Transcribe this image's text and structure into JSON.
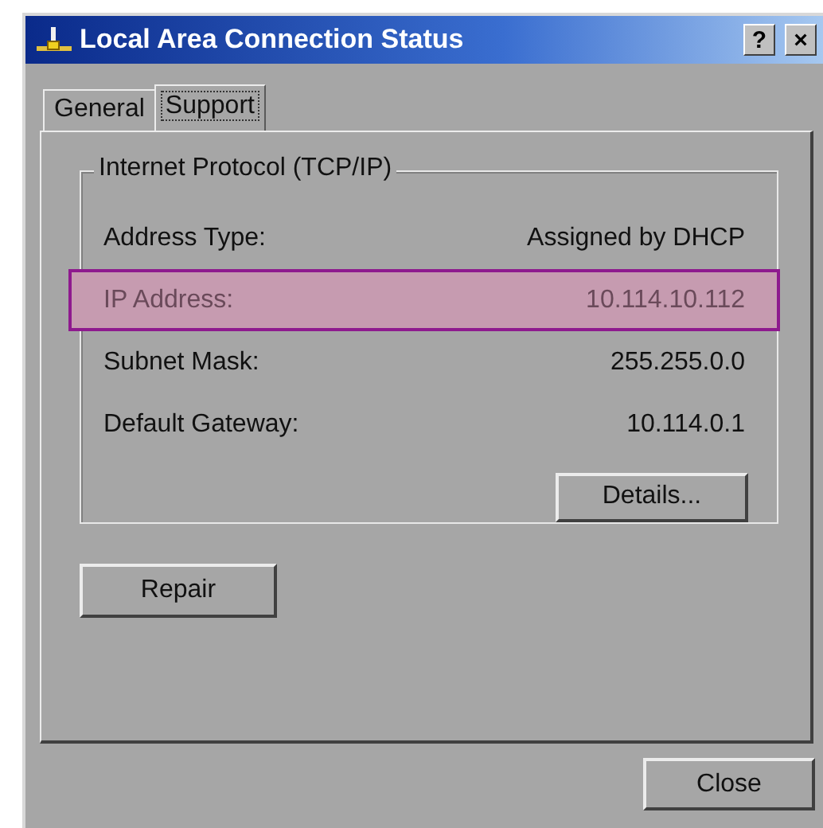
{
  "window": {
    "title": "Local Area Connection Status",
    "title_buttons": [
      "?",
      "×"
    ]
  },
  "tabs": [
    {
      "label": "General",
      "selected": false
    },
    {
      "label": "Support",
      "selected": true
    }
  ],
  "group": {
    "title": "Internet Protocol (TCP/IP)",
    "rows": [
      {
        "label": "Address Type:",
        "value": "Assigned by DHCP",
        "highlighted": false
      },
      {
        "label": "IP Address:",
        "value": "10.114.10.112",
        "highlighted": true
      },
      {
        "label": "Subnet Mask:",
        "value": "255.255.0.0",
        "highlighted": false
      },
      {
        "label": "Default Gateway:",
        "value": "10.114.0.1",
        "highlighted": false
      }
    ],
    "button": "Details..."
  },
  "repair_button": "Repair",
  "close_button": "Close"
}
